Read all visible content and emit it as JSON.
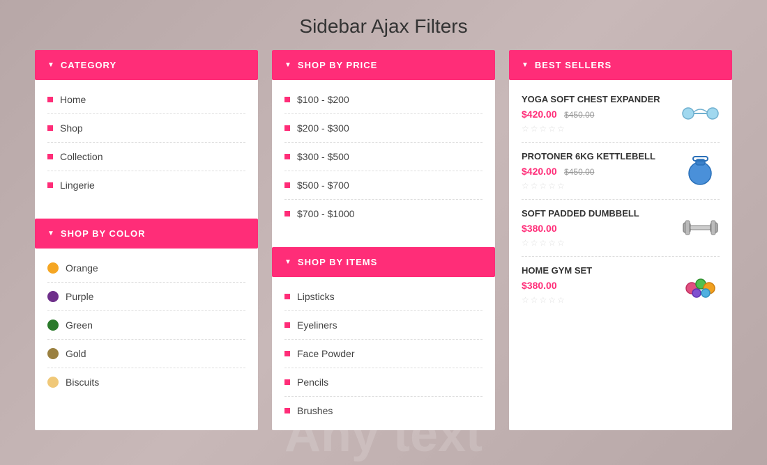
{
  "page": {
    "title": "Sidebar Ajax Filters",
    "bottom_text": "Any text"
  },
  "category_panel": {
    "header": "CATEGORY",
    "items": [
      {
        "label": "Home"
      },
      {
        "label": "Shop"
      },
      {
        "label": "Collection"
      },
      {
        "label": "Lingerie"
      }
    ]
  },
  "shop_by_color_panel": {
    "header": "SHOP BY COLOR",
    "items": [
      {
        "label": "Orange",
        "color": "#f5a623"
      },
      {
        "label": "Purple",
        "color": "#6e2f8a"
      },
      {
        "label": "Green",
        "color": "#2a7a2a"
      },
      {
        "label": "Gold",
        "color": "#9a8040"
      },
      {
        "label": "Biscuits",
        "color": "#f0c878"
      }
    ]
  },
  "shop_by_price_panel": {
    "header": "SHOP BY PRICE",
    "items": [
      {
        "label": "$100 - $200"
      },
      {
        "label": "$200 - $300"
      },
      {
        "label": "$300 - $500"
      },
      {
        "label": "$500 - $700"
      },
      {
        "label": "$700 - $1000"
      }
    ]
  },
  "shop_by_items_panel": {
    "header": "SHOP BY ITEMS",
    "items": [
      {
        "label": "Lipsticks"
      },
      {
        "label": "Eyeliners"
      },
      {
        "label": "Face Powder"
      },
      {
        "label": "Pencils"
      },
      {
        "label": "Brushes"
      }
    ]
  },
  "best_sellers_panel": {
    "header": "BEST SELLERS",
    "products": [
      {
        "name": "YOGA SOFT CHEST EXPANDER",
        "price": "$420.00",
        "old_price": "$450.00",
        "stars": "☆☆☆☆☆",
        "img_type": "expander"
      },
      {
        "name": "PROTONER 6KG KETTLEBELL",
        "price": "$420.00",
        "old_price": "$450.00",
        "stars": "☆☆☆☆☆",
        "img_type": "kettlebell"
      },
      {
        "name": "SOFT PADDED DUMBBELL",
        "price": "$380.00",
        "old_price": "",
        "stars": "☆☆☆☆☆",
        "img_type": "dumbbell"
      },
      {
        "name": "HOME GYM SET",
        "price": "$380.00",
        "old_price": "",
        "stars": "☆☆☆☆☆",
        "img_type": "gymset"
      }
    ]
  },
  "colors": {
    "accent": "#ff2d78"
  }
}
